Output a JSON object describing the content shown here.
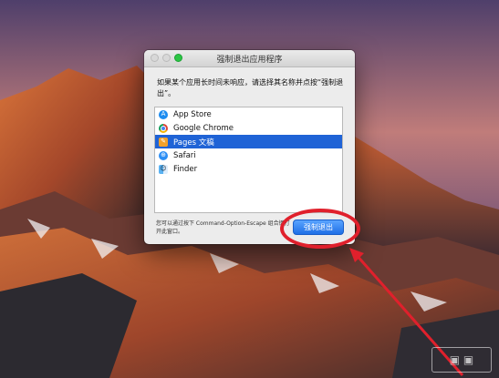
{
  "window": {
    "title": "强制退出应用程序",
    "prompt": "如果某个应用长时间未响应，请选择其名称并点按“强制退出”。",
    "apps": [
      {
        "name": "App Store",
        "icon": "app-store-icon",
        "selected": false
      },
      {
        "name": "Google Chrome",
        "icon": "chrome-icon",
        "selected": false
      },
      {
        "name": "Pages 文稿",
        "icon": "pages-icon",
        "selected": true
      },
      {
        "name": "Safari",
        "icon": "safari-icon",
        "selected": false
      },
      {
        "name": "Finder",
        "icon": "finder-icon",
        "selected": false
      }
    ],
    "hint": "您可以通过按下 Command-Option-Escape 组合键打开此窗口。",
    "force_quit_label": "强制退出"
  },
  "colors": {
    "selection": "#1f63d6",
    "button": "#1f6fe6",
    "annotation": "#e0202c"
  }
}
